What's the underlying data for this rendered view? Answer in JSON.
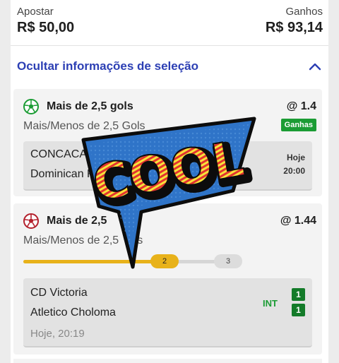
{
  "stake": {
    "bet_label": "Apostar",
    "bet_value": "R$ 50,00",
    "win_label": "Ganhos",
    "win_value": "R$ 93,14"
  },
  "toggle_label": "Ocultar informações de seleção",
  "selections": [
    {
      "pick": "Mais de 2,5 gols",
      "odds": "@ 1.4",
      "market": "Mais/Menos de 2,5 Gols",
      "status": "Ganhas",
      "home": "CONCACAF L",
      "away": "Dominican Re",
      "day": "Hoje",
      "time": "20:00",
      "ball_color": "#1b9c34"
    },
    {
      "pick": "Mais de 2,5",
      "odds": "@ 1.44",
      "market": "Mais/Menos de 2,5",
      "market_tail": "s",
      "progress_current": "2",
      "progress_next": "3",
      "progress_fraction": 0.7,
      "home": "CD Victoria",
      "away": "Atletico Choloma",
      "kickoff": "Hoje, 20:19",
      "period": "INT",
      "home_score": "1",
      "away_score": "1",
      "ball_color": "#b3202c"
    }
  ],
  "sticker_text": "COOL",
  "colors": {
    "accent_blue": "#2c3fb4",
    "won_green": "#1b9c34",
    "progress_yellow": "#e8b21a",
    "sticker_blue": "#2f74c8",
    "sticker_yellow": "#f7e23a",
    "sticker_red": "#e2332f"
  }
}
